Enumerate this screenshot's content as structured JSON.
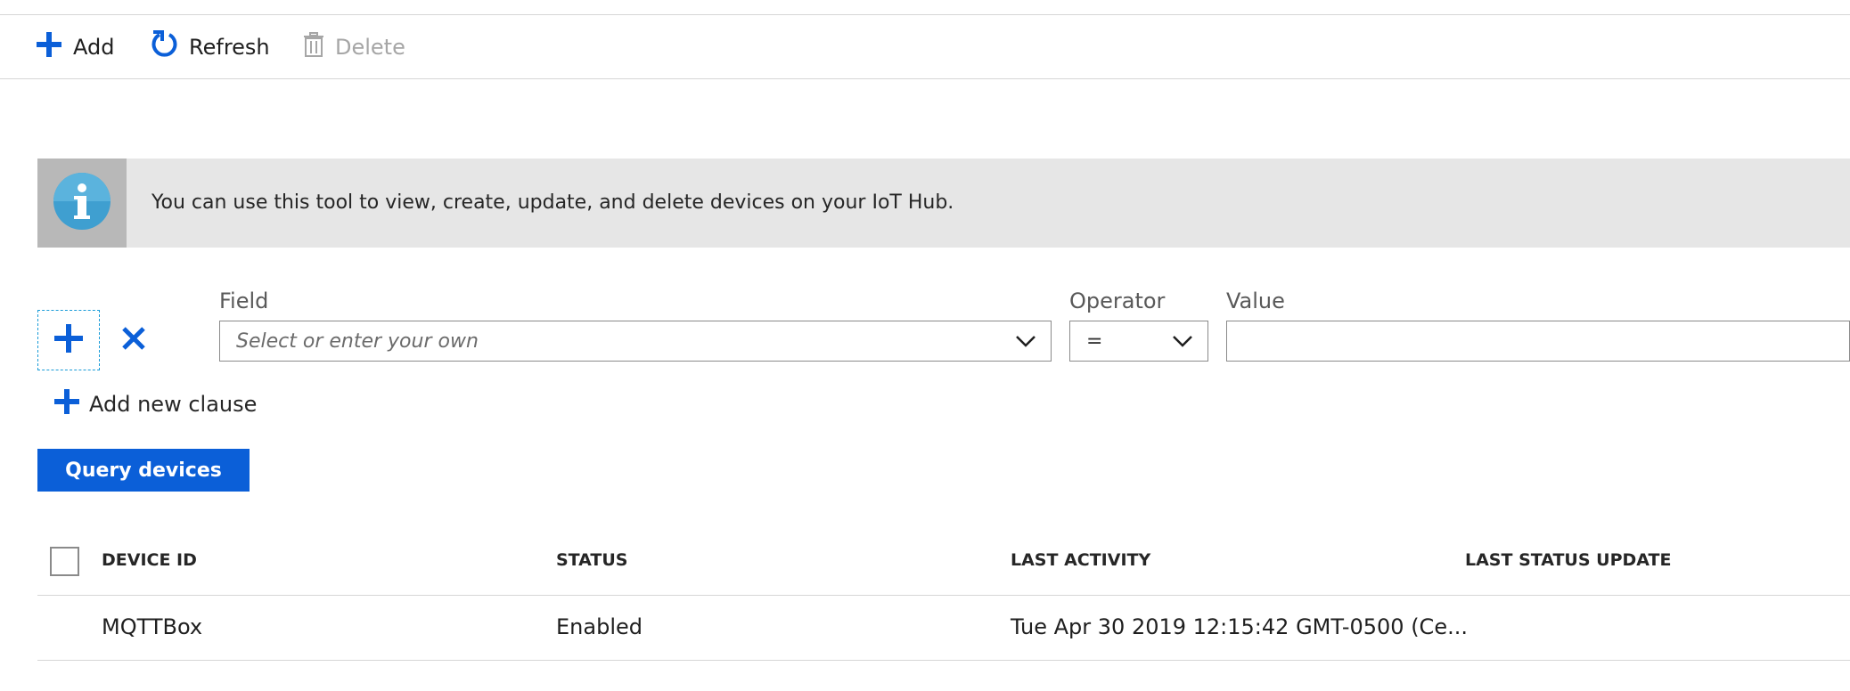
{
  "toolbar": {
    "add_label": "Add",
    "refresh_label": "Refresh",
    "delete_label": "Delete"
  },
  "info": {
    "text": "You can use this tool to view, create, update, and delete devices on your IoT Hub."
  },
  "filter": {
    "field_label": "Field",
    "operator_label": "Operator",
    "value_label": "Value",
    "field_placeholder": "Select or enter your own",
    "operator_value": "=",
    "value_text": ""
  },
  "add_clause_label": "Add new clause",
  "query_button_label": "Query devices",
  "table": {
    "headers": [
      "DEVICE ID",
      "STATUS",
      "LAST ACTIVITY",
      "LAST STATUS UPDATE"
    ],
    "rows": [
      {
        "device_id": "MQTTBox",
        "status": "Enabled",
        "last_activity": "Tue Apr 30 2019 12:15:42 GMT-0500 (Ce...",
        "last_status_update": ""
      }
    ]
  },
  "colors": {
    "accent": "#0b5fd8",
    "info_icon": "#3f9fd0",
    "banner_bg": "#e6e6e6"
  },
  "icons": {
    "add": "plus-icon",
    "refresh": "refresh-icon",
    "delete": "trash-icon",
    "info": "info-icon",
    "remove": "close-icon",
    "dropdown": "chevron-down-icon"
  }
}
